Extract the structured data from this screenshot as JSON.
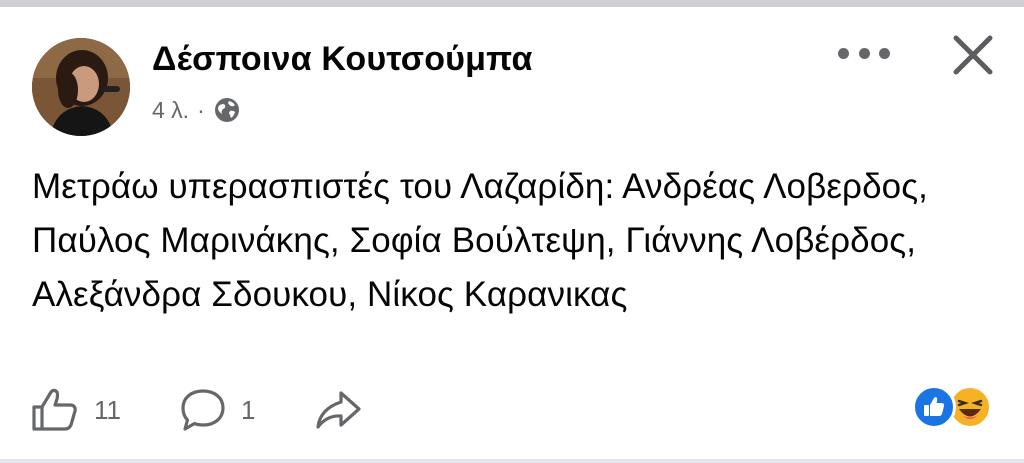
{
  "post": {
    "author": "Δέσποινα Κουτσούμπα",
    "time": "4 λ.",
    "separator": "·",
    "privacy_icon": "globe-icon",
    "text": "Μετράω υπερασπιστές του Λαζαρίδη: Ανδρέας Λοβερδος, Παύλος Μαρινάκης, Σοφία Βούλτεψη, Γιάννης Λοβέρδος, Αλεξάνδρα Σδουκου, Νίκος Καρανικας"
  },
  "header": {
    "more_icon": "more-options-icon",
    "close_icon": "close-icon"
  },
  "actions": {
    "like_count": "11",
    "comment_count": "1",
    "like_icon": "thumbs-up-icon",
    "comment_icon": "comment-bubble-icon",
    "share_icon": "share-arrow-icon"
  },
  "reactions": {
    "icons": [
      "like-reaction-icon",
      "haha-reaction-icon"
    ]
  },
  "colors": {
    "text": "#050505",
    "secondary": "#65676b",
    "like_blue": "#1b74e4",
    "haha_yellow": "#f7b125"
  }
}
